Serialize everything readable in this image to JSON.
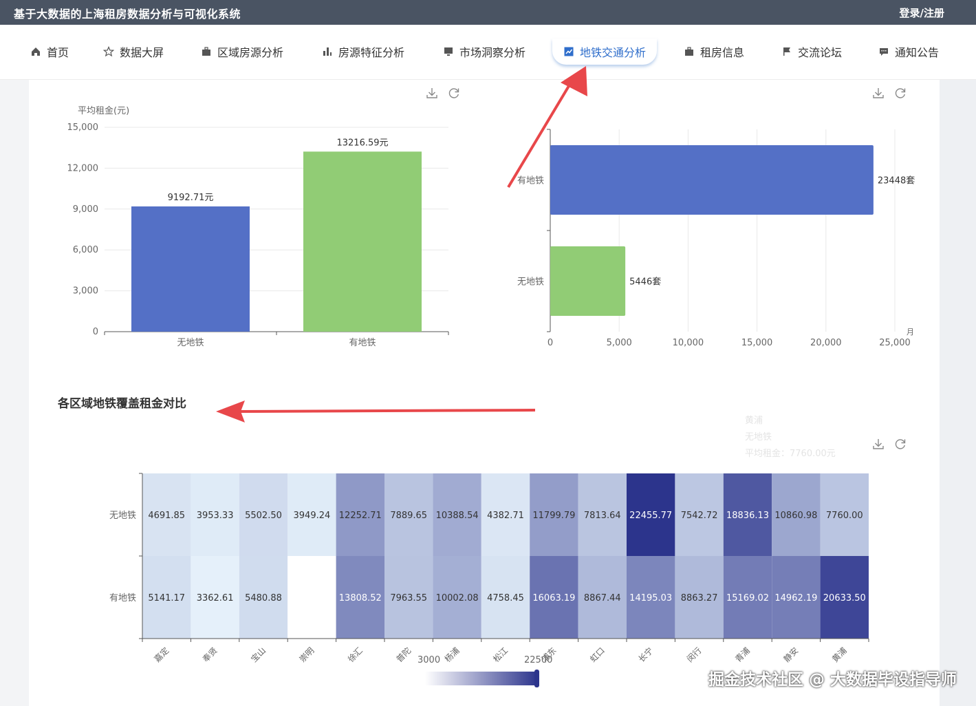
{
  "header": {
    "title": "基于大数据的上海租房数据分析与可视化系统",
    "login": "登录/注册"
  },
  "nav": [
    {
      "label": "首页",
      "icon": "home-icon"
    },
    {
      "label": "数据大屏",
      "icon": "star-icon"
    },
    {
      "label": "区域房源分析",
      "icon": "briefcase-icon"
    },
    {
      "label": "房源特征分析",
      "icon": "bar-chart-icon"
    },
    {
      "label": "市场洞察分析",
      "icon": "monitor-icon"
    },
    {
      "label": "地铁交通分析",
      "icon": "line-chart-icon",
      "active": true
    },
    {
      "label": "租房信息",
      "icon": "briefcase-icon"
    },
    {
      "label": "交流论坛",
      "icon": "flag-icon"
    },
    {
      "label": "通知公告",
      "icon": "message-icon"
    }
  ],
  "section_title": "各区域地铁覆盖租金对比",
  "watermark": "掘金技术社区 @ 大数据毕设指导师",
  "tooltip_ghost": {
    "line1": "黄浦",
    "line2": "无地铁",
    "line3": "平均租金：7760.00元"
  },
  "chart_data": [
    {
      "type": "bar",
      "ylabel": "平均租金(元)",
      "categories": [
        "无地铁",
        "有地铁"
      ],
      "values": [
        9192.71,
        13216.59
      ],
      "data_labels": [
        "9192.71元",
        "13216.59元"
      ],
      "ylim": [
        0,
        15000
      ],
      "yticks": [
        "0",
        "3,000",
        "6,000",
        "9,000",
        "12,000",
        "15,000"
      ],
      "colors": [
        "#5470c6",
        "#91cc75"
      ],
      "grid": true
    },
    {
      "type": "bar",
      "orientation": "horizontal",
      "categories": [
        "有地铁",
        "无地铁"
      ],
      "values": [
        23448,
        5446
      ],
      "data_labels": [
        "23448套",
        "5446套"
      ],
      "xlim": [
        0,
        25000
      ],
      "xticks": [
        "0",
        "5,000",
        "10,000",
        "15,000",
        "20,000",
        "25,000"
      ],
      "colors": [
        "#5470c6",
        "#91cc75"
      ],
      "axis_unit_clipped": "月",
      "grid": true
    },
    {
      "type": "heatmap",
      "x": [
        "嘉定",
        "奉贤",
        "宝山",
        "崇明",
        "徐汇",
        "普陀",
        "杨浦",
        "松江",
        "浦东",
        "虹口",
        "长宁",
        "闵行",
        "青浦",
        "静安",
        "黄浦"
      ],
      "y": [
        "无地铁",
        "有地铁"
      ],
      "values": [
        [
          4691.85,
          3953.33,
          5502.5,
          3949.24,
          12252.71,
          7889.65,
          10388.54,
          4382.71,
          11799.79,
          7813.64,
          22455.77,
          7542.72,
          18836.13,
          10860.98,
          7760.0
        ],
        [
          5141.17,
          3362.61,
          5480.88,
          null,
          13808.52,
          7963.55,
          10002.08,
          4758.45,
          16063.19,
          8867.44,
          14195.03,
          8863.27,
          15169.02,
          14962.19,
          20633.5
        ]
      ],
      "labels": [
        [
          "4691.85",
          "3953.33",
          "5502.50",
          "3949.24",
          "12252.71",
          "7889.65",
          "10388.54",
          "4382.71",
          "11799.79",
          "7813.64",
          "22455.77",
          "7542.72",
          "18836.13",
          "10860.98",
          "7760.00"
        ],
        [
          "5141.17",
          "3362.61",
          "5480.88",
          "",
          "13808.52",
          "7963.55",
          "10002.08",
          "4758.45",
          "16063.19",
          "8867.44",
          "14195.03",
          "8863.27",
          "15169.02",
          "14962.19",
          "20633.50"
        ]
      ],
      "visual_map": {
        "min": 3000,
        "max": 22500,
        "min_label": "3000",
        "max_label": "22500",
        "color_low": "#e8f4fc",
        "color_high": "#2c348c"
      }
    }
  ]
}
